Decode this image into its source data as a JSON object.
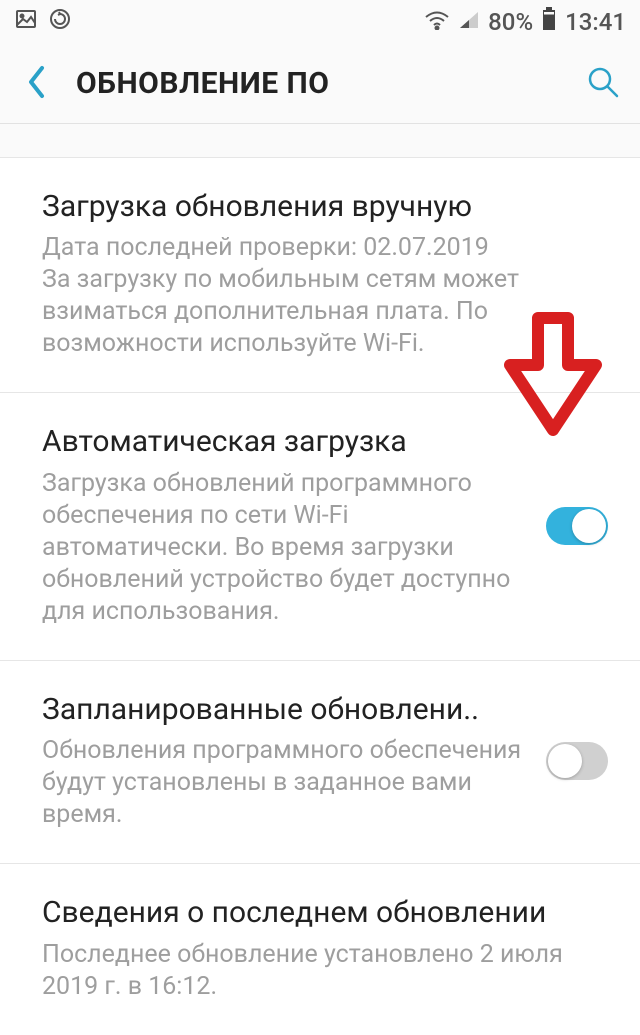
{
  "status": {
    "battery_pct": "80%",
    "time": "13:41"
  },
  "header": {
    "title": "ОБНОВЛЕНИЕ ПО"
  },
  "items": {
    "manual": {
      "title": "Загрузка обновления вручную",
      "desc": "Дата последней проверки: 02.07.2019\nЗа загрузку по мобильным сетям может взиматься дополнительная плата. По возможности используйте Wi-Fi."
    },
    "auto": {
      "title": "Автоматическая загрузка",
      "desc": "Загрузка обновлений программного обеспечения по сети Wi-Fi автоматически. Во время загрузки обновлений устройство будет доступно для использования.",
      "toggle": true
    },
    "scheduled": {
      "title": "Запланированные обновлени..",
      "desc": "Обновления программного обеспечения будут установлены в заданное вами время.",
      "toggle": false
    },
    "last": {
      "title": "Сведения о последнем обновлении",
      "desc": "Последнее обновление установлено 2 июля 2019 г. в 16:12."
    }
  }
}
